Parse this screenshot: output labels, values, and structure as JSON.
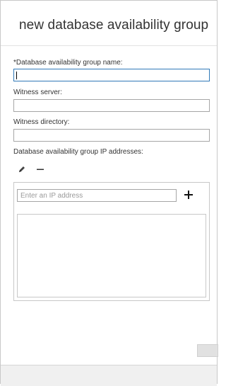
{
  "dialog": {
    "title": "new database availability group"
  },
  "form": {
    "dag_name": {
      "label": "*Database availability group name:",
      "value": ""
    },
    "witness_server": {
      "label": "Witness server:",
      "value": ""
    },
    "witness_directory": {
      "label": "Witness directory:",
      "value": ""
    },
    "ip_addresses": {
      "label": "Database availability group IP addresses:",
      "placeholder": "Enter an IP address",
      "items": []
    }
  },
  "toolbar": {
    "edit_icon": "pencil-icon",
    "remove_icon": "minus-icon",
    "add_icon": "plus-icon"
  },
  "colors": {
    "focus_border": "#3079b8",
    "field_border": "#a6a6a6",
    "footer_bg": "#f0f0f0"
  }
}
